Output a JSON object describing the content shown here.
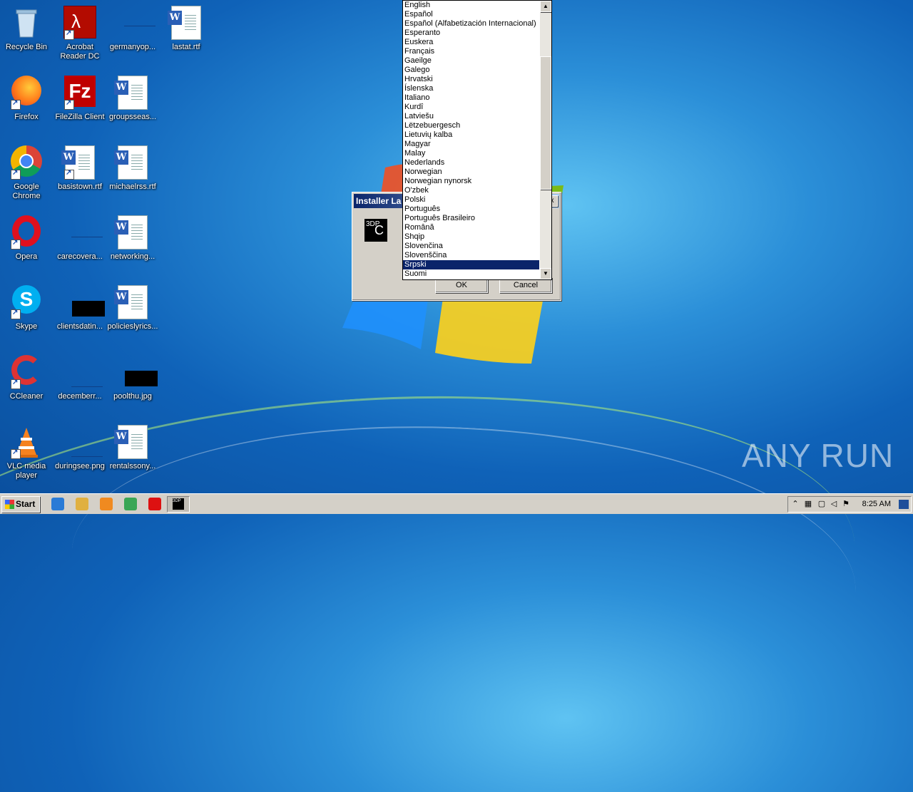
{
  "desktop": {
    "icons": [
      {
        "label": "Recycle Bin"
      },
      {
        "label": "Acrobat Reader DC"
      },
      {
        "label": "germanyop..."
      },
      {
        "label": "lastat.rtf"
      },
      {
        "label": "Firefox"
      },
      {
        "label": "FileZilla Client"
      },
      {
        "label": "groupsseas..."
      },
      {
        "label": "Google Chrome"
      },
      {
        "label": "basistown.rtf"
      },
      {
        "label": "michaelrss.rtf"
      },
      {
        "label": "Opera"
      },
      {
        "label": "carecovera..."
      },
      {
        "label": "networking..."
      },
      {
        "label": "Skype"
      },
      {
        "label": "clientsdatin..."
      },
      {
        "label": "policieslyrics..."
      },
      {
        "label": "CCleaner"
      },
      {
        "label": "decemberr..."
      },
      {
        "label": "poolthu.jpg"
      },
      {
        "label": "VLC media player"
      },
      {
        "label": "duringsee.png"
      },
      {
        "label": "rentalssony..."
      }
    ]
  },
  "dialog": {
    "title": "Installer La",
    "app_icon_text": "3DP",
    "app_icon_letter": "C",
    "ok_label": "OK",
    "cancel_label": "Cancel",
    "close_glyph": "x"
  },
  "language_list": {
    "items": [
      "English",
      "Español",
      "Español (Alfabetización Internacional)",
      "Esperanto",
      "Euskera",
      "Français",
      "Gaeilge",
      "Galego",
      "Hrvatski",
      "Íslenska",
      "Italiano",
      "Kurdî",
      "Latviešu",
      "Lëtzebuergesch",
      "Lietuvių kalba",
      "Magyar",
      "Malay",
      "Nederlands",
      "Norwegian",
      "Norwegian nynorsk",
      "O'zbek",
      "Polski",
      "Português",
      "Português Brasileiro",
      "Română",
      "Shqip",
      "Slovenčina",
      "Slovenščina",
      "Srpski",
      "Suomi"
    ],
    "selected": "Srpski",
    "scroll_up_glyph": "▲",
    "scroll_down_glyph": "▼"
  },
  "taskbar": {
    "start_label": "Start",
    "clock": "8:25 AM",
    "pinned": [
      {
        "name": "internet-explorer-icon",
        "color": "#2a7bd6"
      },
      {
        "name": "file-explorer-icon",
        "color": "#e0b040"
      },
      {
        "name": "media-player-icon",
        "color": "#f08a20"
      },
      {
        "name": "chrome-icon",
        "color": "#3aa655"
      },
      {
        "name": "opera-icon",
        "color": "#d11"
      }
    ],
    "active_app_text": "3DP"
  },
  "watermark": "ANY RUN"
}
